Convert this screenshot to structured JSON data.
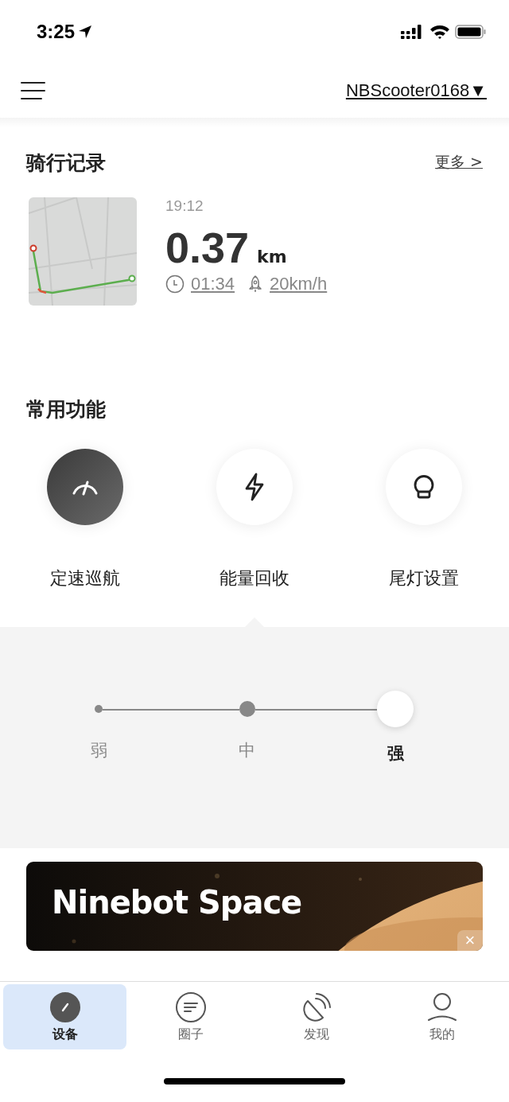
{
  "status_bar": {
    "time": "3:25"
  },
  "header": {
    "device": "NBScooter0168▼"
  },
  "ride_records": {
    "title": "骑行记录",
    "more": "更多 >",
    "time": "19:12",
    "distance": "0.37",
    "unit": "km",
    "duration": "01:34",
    "speed": "20km/h"
  },
  "functions": {
    "title": "常用功能",
    "items": [
      {
        "kind": "speedometer",
        "label": "定速巡航",
        "on": true,
        "expanded": false
      },
      {
        "kind": "bolt",
        "label": "能量回收",
        "on": false,
        "expanded": true
      },
      {
        "kind": "bulb",
        "label": "尾灯设置",
        "on": false,
        "expanded": false
      }
    ]
  },
  "recovery": {
    "options": [
      {
        "label": "弱",
        "selected": false
      },
      {
        "label": "中",
        "selected": false
      },
      {
        "label": "强",
        "selected": true
      }
    ]
  },
  "banner": {
    "title": "Ninebot Space",
    "close": "×"
  },
  "tabs": [
    {
      "kind": "device",
      "label": "设备",
      "selected": true
    },
    {
      "kind": "circle",
      "label": "圈子",
      "selected": false
    },
    {
      "kind": "discover",
      "label": "发现",
      "selected": false
    },
    {
      "kind": "me",
      "label": "我的",
      "selected": false
    }
  ]
}
